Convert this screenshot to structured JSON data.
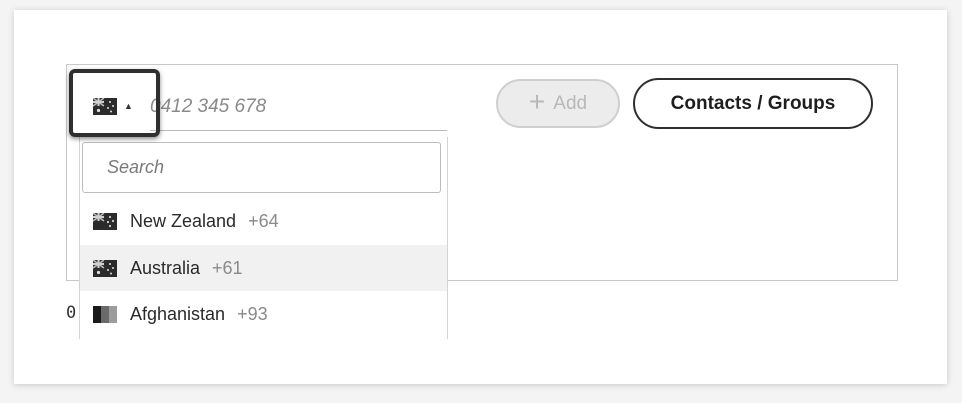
{
  "phone": {
    "placeholder": "0412 345 678",
    "selected_country_flag": "australia-flag"
  },
  "buttons": {
    "add_label": "Add",
    "add_icon": "plus-icon",
    "contacts_groups_label": "Contacts / Groups"
  },
  "country_dropdown": {
    "search_placeholder": "Search",
    "countries": [
      {
        "name": "New Zealand",
        "code": "+64",
        "flag": "new-zealand-flag"
      },
      {
        "name": "Australia",
        "code": "+61",
        "flag": "australia-flag",
        "highlighted": true
      },
      {
        "name": "Afghanistan",
        "code": "+93",
        "flag": "afghanistan-flag"
      }
    ]
  },
  "stray_text": "0",
  "colors": {
    "accent_border": "#2f2f2f",
    "disabled_button_bg": "#ececec",
    "highlight_row_bg": "#f1f1f1"
  }
}
